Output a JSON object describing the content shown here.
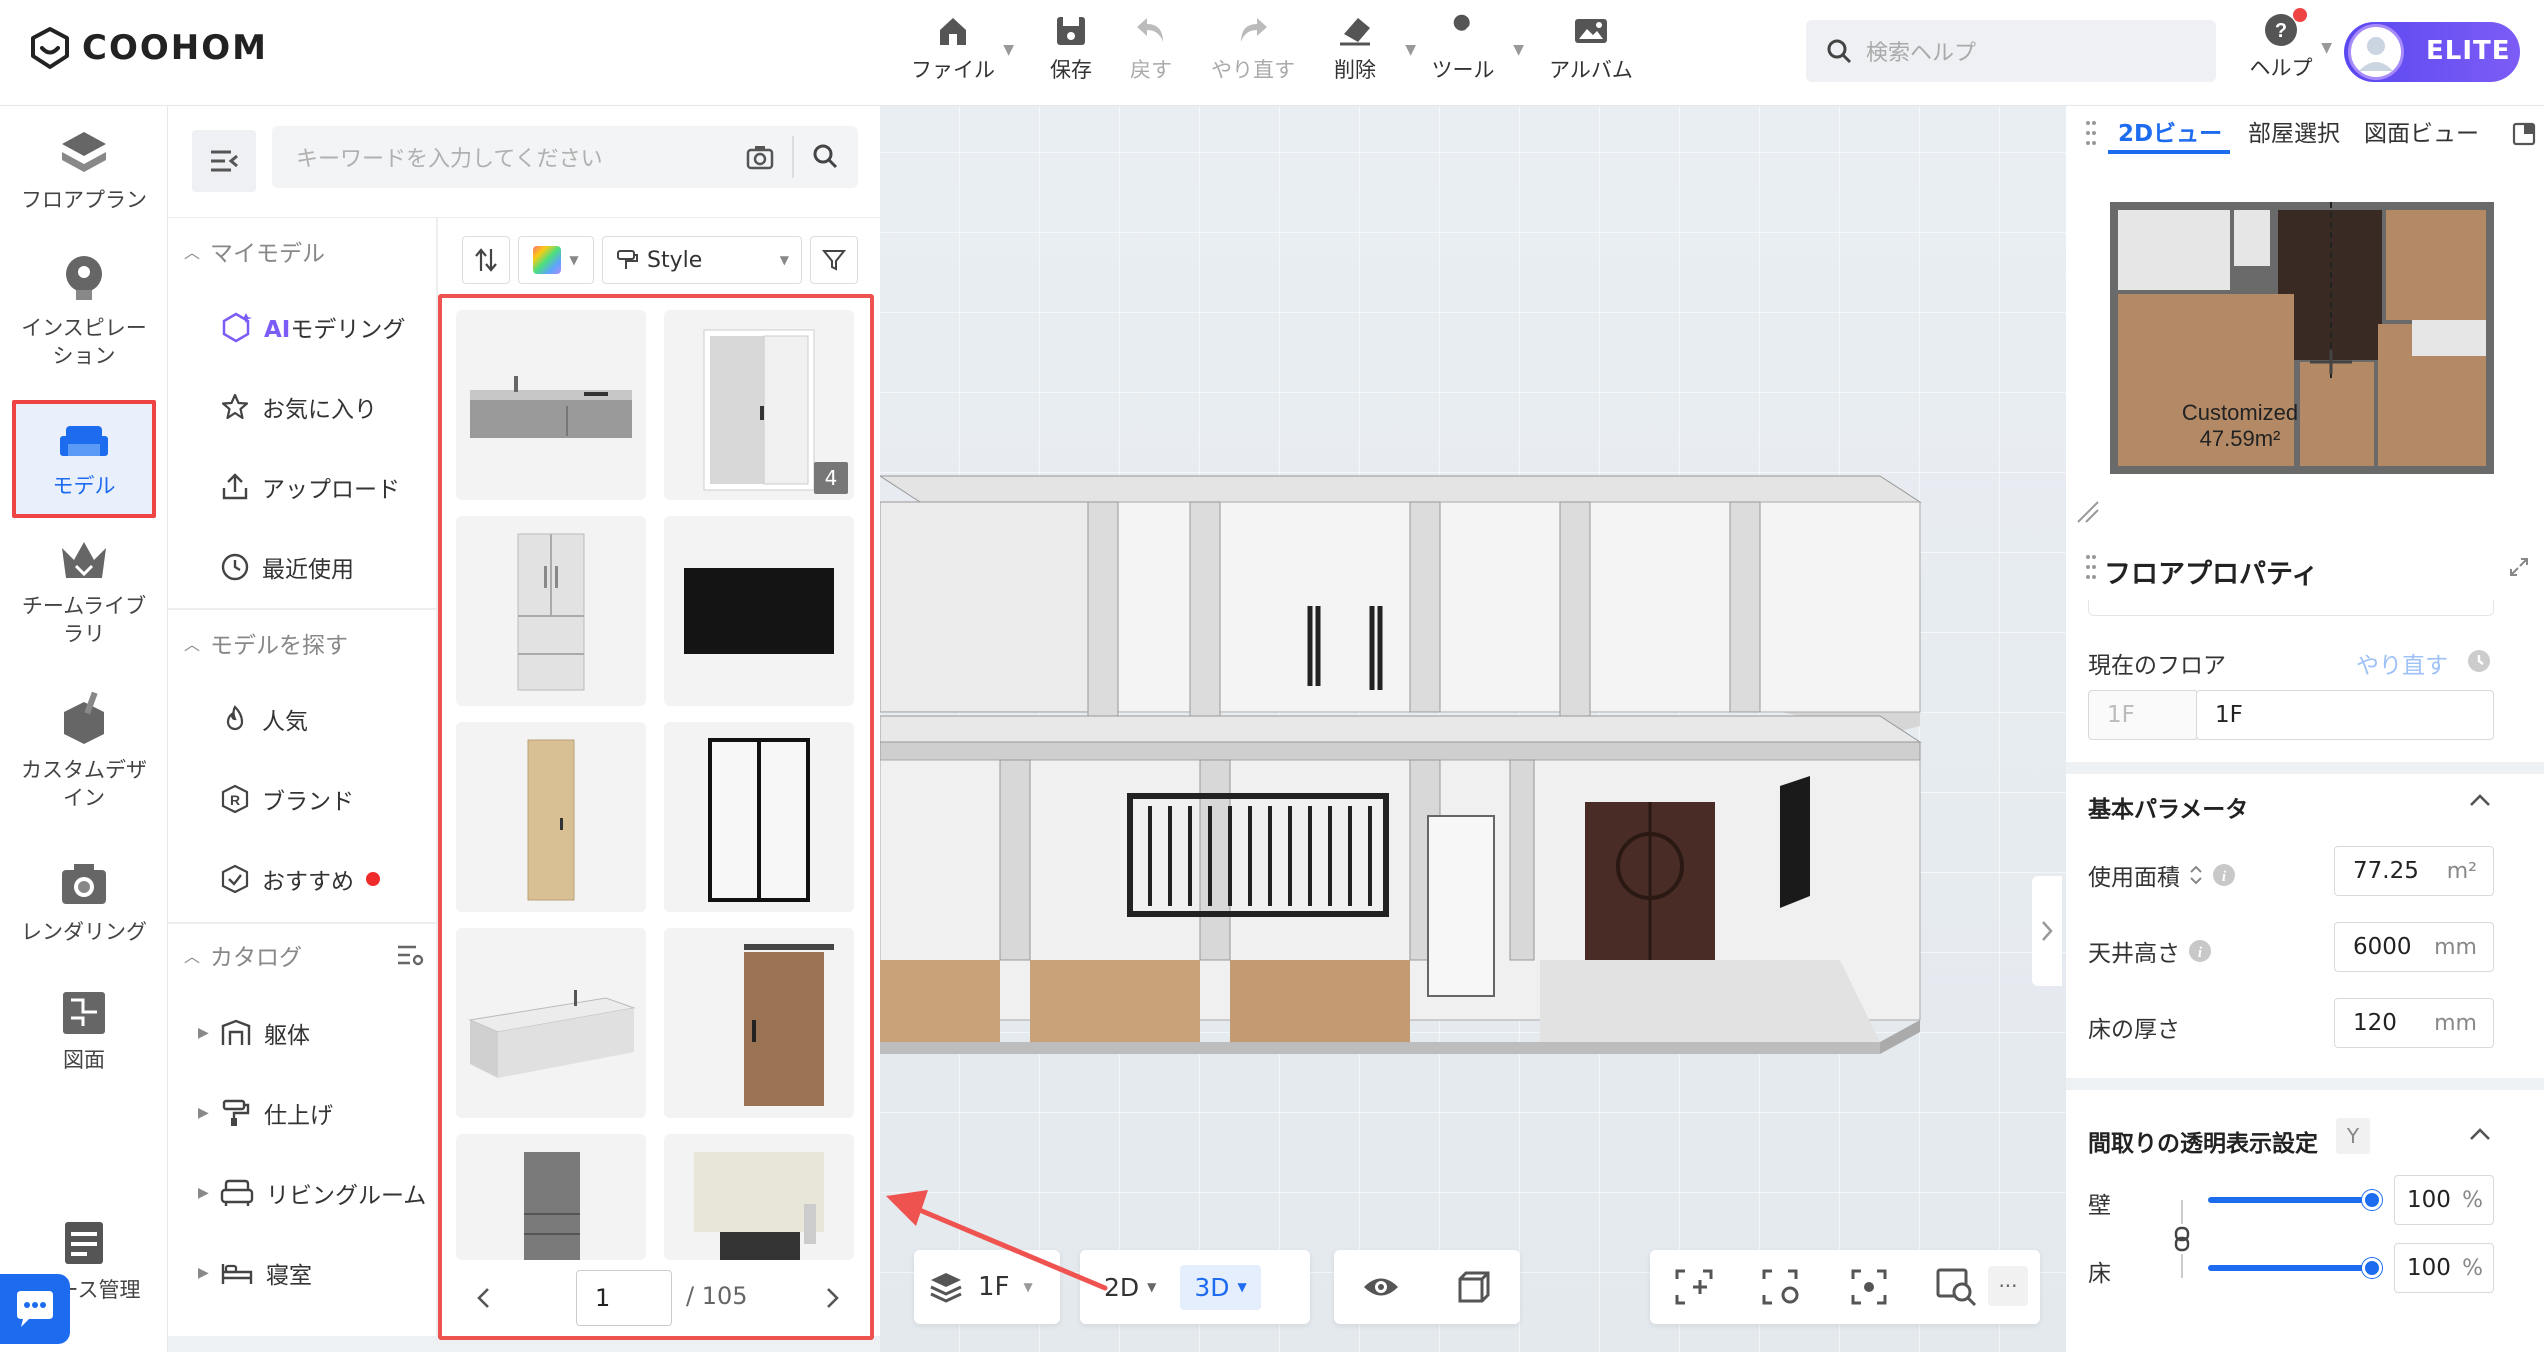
{
  "app": {
    "brand": "COOHOM"
  },
  "toolbar": {
    "file": "ファイル",
    "save": "保存",
    "undo": "戻す",
    "redo": "やり直す",
    "delete": "削除",
    "tools": "ツール",
    "album": "アルバム"
  },
  "help_search": {
    "placeholder": "検索ヘルプ"
  },
  "help": {
    "label": "ヘルプ"
  },
  "user": {
    "badge": "ELITE"
  },
  "leftnav": {
    "floorplan": "フロアプラン",
    "inspiration": "インスピレーション",
    "model": "モデル",
    "team_library": "チームライブラリ",
    "custom_design": "カスタムデザイン",
    "rendering": "レンダリング",
    "drawing": "図面",
    "case_mgmt": "ース管理"
  },
  "keyword_search": {
    "placeholder": "キーワードを入力してください"
  },
  "categories": {
    "my_models": "マイモデル",
    "ai_modeling_prefix": "AI",
    "ai_modeling": "モデリング",
    "favorites": "お気に入り",
    "upload": "アップロード",
    "recent": "最近使用",
    "find_models": "モデルを探す",
    "popular": "人気",
    "brand": "ブランド",
    "recommended": "おすすめ",
    "catalog": "カタログ",
    "structure": "躯体",
    "finishing": "仕上げ",
    "living": "リビングルーム",
    "bedroom": "寝室"
  },
  "filters": {
    "style": "Style"
  },
  "grid": {
    "badge_count": "4"
  },
  "pager": {
    "current": "1",
    "total": "/ 105"
  },
  "viewport": {
    "floor": "1F",
    "view_2d": "2D",
    "view_3d": "3D"
  },
  "minimap": {
    "tab_2d": "2Dビュー",
    "tab_room": "部屋選択",
    "tab_plan": "図面ビュー",
    "room_name": "Customized",
    "room_area": "47.59m²"
  },
  "props": {
    "title": "フロアプロパティ",
    "current_floor": "現在のフロア",
    "redo": "やり直す",
    "floor_prefix": "1F",
    "floor_name": "1F",
    "basic_params": "基本パラメータ",
    "area_label": "使用面積",
    "area_value": "77.25",
    "area_unit": "m²",
    "ceiling_label": "天井高さ",
    "ceiling_value": "6000",
    "ceiling_unit": "mm",
    "floor_thick_label": "床の厚さ",
    "floor_thick_value": "120",
    "floor_thick_unit": "mm",
    "transparency_title": "間取りの透明表示設定",
    "transparency_key": "Y",
    "wall_label": "壁",
    "wall_value": "100",
    "floor_label": "床",
    "floor_value": "100",
    "percent": "%"
  },
  "colors": {
    "accent": "#1d6cf0",
    "highlight": "#ef4444",
    "elite": "#6a4cf4"
  }
}
